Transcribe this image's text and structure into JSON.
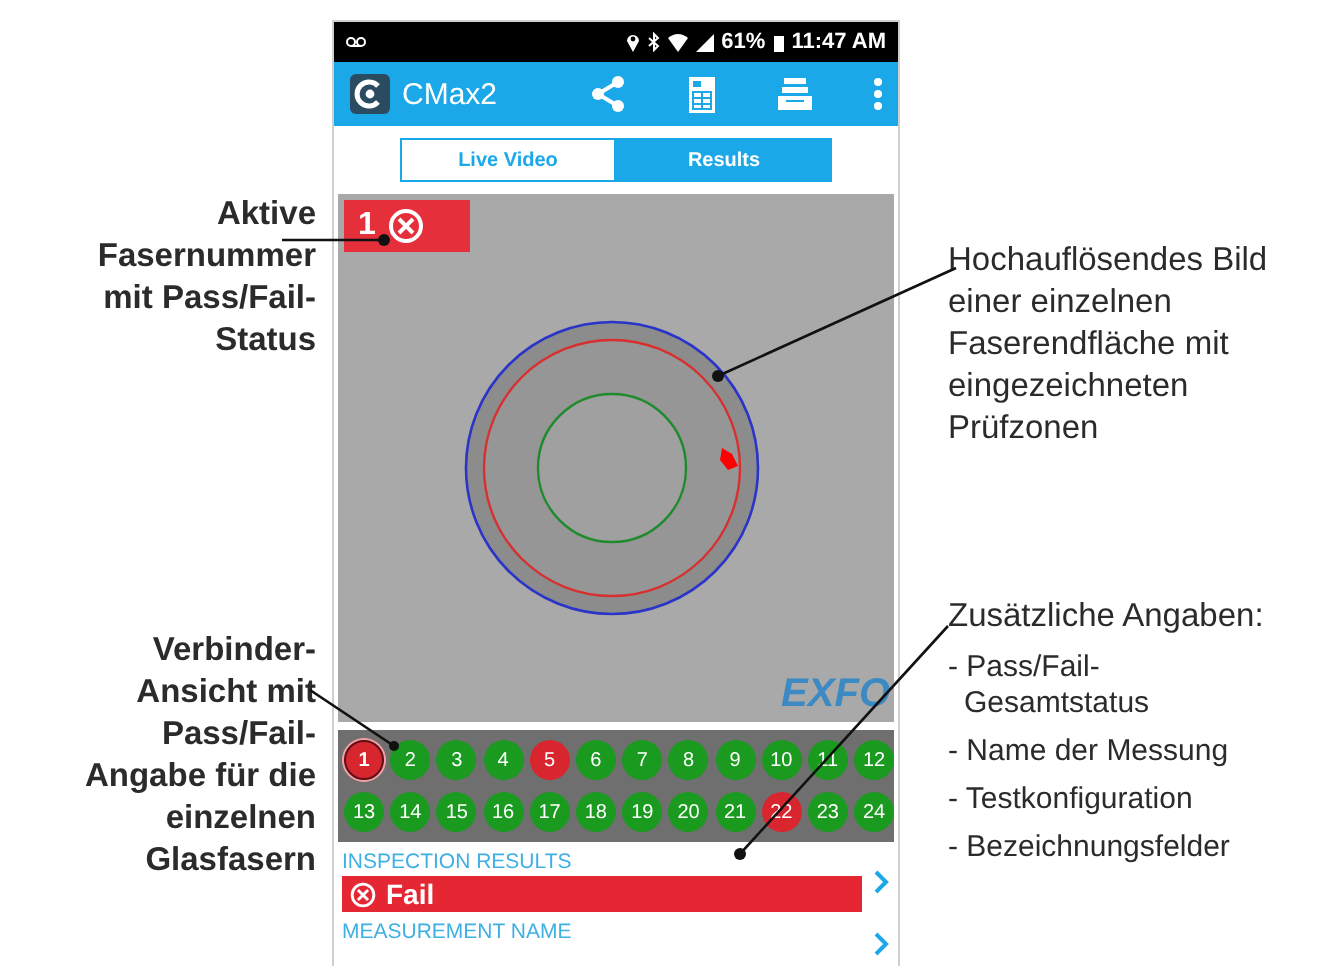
{
  "callouts_left": [
    {
      "text": "Aktive Fasernummer mit Pass/Fail-Status"
    },
    {
      "text": "Verbinder-Ansicht mit Pass/Fail-Angabe für die einzelnen Glasfasern"
    }
  ],
  "callouts_right": [
    {
      "text": "Hochauflösendes Bild einer einzelnen Faserendfläche mit eingezeichneten Prüfzonen"
    },
    {
      "text": "Zusätzliche Angaben:",
      "items": [
        "- Pass/Fail-Gesamtstatus",
        "- Name der Messung",
        "- Testkonfiguration",
        "-  Bezeichnungsfelder"
      ]
    }
  ],
  "status_bar": {
    "battery": "61%",
    "time": "11:47 AM"
  },
  "app_bar": {
    "title": "CMax2"
  },
  "tabs": [
    {
      "label": "Live Video",
      "selected": false
    },
    {
      "label": "Results",
      "selected": true
    }
  ],
  "image": {
    "logo": "EXFO",
    "active_fiber": {
      "number": "1",
      "failed": true
    }
  },
  "fibers": [
    {
      "number": "1",
      "failed": true,
      "selected": true
    },
    {
      "number": "2",
      "failed": false,
      "selected": false
    },
    {
      "number": "3",
      "failed": false,
      "selected": false
    },
    {
      "number": "4",
      "failed": false,
      "selected": false
    },
    {
      "number": "5",
      "failed": true,
      "selected": false
    },
    {
      "number": "6",
      "failed": false,
      "selected": false
    },
    {
      "number": "7",
      "failed": false,
      "selected": false
    },
    {
      "number": "8",
      "failed": false,
      "selected": false
    },
    {
      "number": "9",
      "failed": false,
      "selected": false
    },
    {
      "number": "10",
      "failed": false,
      "selected": false
    },
    {
      "number": "11",
      "failed": false,
      "selected": false
    },
    {
      "number": "12",
      "failed": false,
      "selected": false
    },
    {
      "number": "13",
      "failed": false,
      "selected": false
    },
    {
      "number": "14",
      "failed": false,
      "selected": false
    },
    {
      "number": "15",
      "failed": false,
      "selected": false
    },
    {
      "number": "16",
      "failed": false,
      "selected": false
    },
    {
      "number": "17",
      "failed": false,
      "selected": false
    },
    {
      "number": "18",
      "failed": false,
      "selected": false
    },
    {
      "number": "19",
      "failed": false,
      "selected": false
    },
    {
      "number": "20",
      "failed": false,
      "selected": false
    },
    {
      "number": "21",
      "failed": false,
      "selected": false
    },
    {
      "number": "22",
      "failed": true,
      "selected": false
    },
    {
      "number": "23",
      "failed": false,
      "selected": false
    },
    {
      "number": "24",
      "failed": false,
      "selected": false
    }
  ],
  "inspection_results": {
    "label": "INSPECTION RESULTS",
    "value": "Fail",
    "failed": true
  },
  "measurement_name": {
    "label": "MEASUREMENT NAME"
  }
}
